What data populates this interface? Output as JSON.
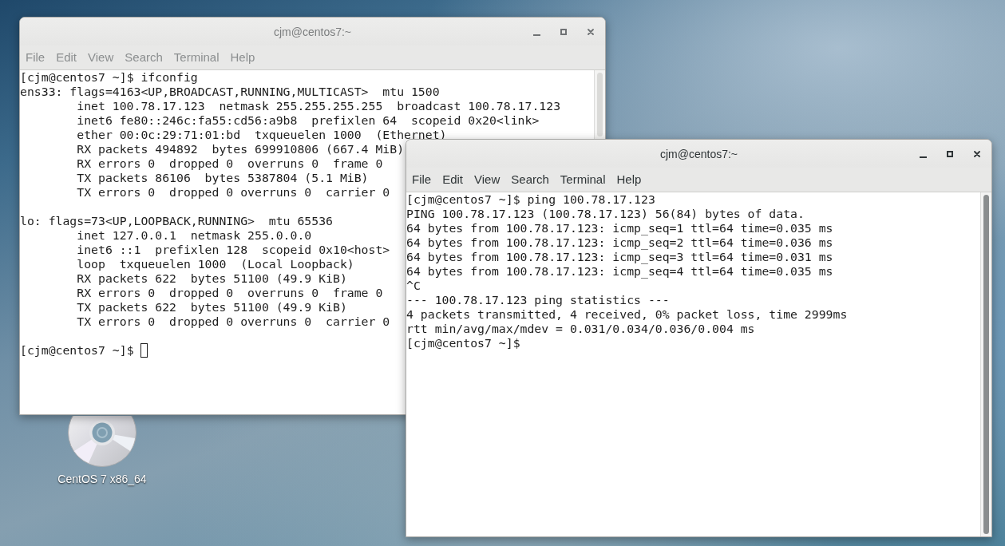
{
  "desktop": {
    "icons": [
      {
        "label": "CentOS 7 x86_64"
      }
    ]
  },
  "windows": [
    {
      "title": "cjm@centos7:~",
      "active": false,
      "menu": [
        "File",
        "Edit",
        "View",
        "Search",
        "Terminal",
        "Help"
      ],
      "cursor": true,
      "blocks": [
        {
          "lines": [
            {
              "text": "[cjm@centos7 ~]$ ifconfig"
            },
            {
              "text": "ens33: flags=4163<UP,BROADCAST,RUNNING,MULTICAST>  mtu 1500",
              "children": [
                {
                  "text": "inet 100.78.17.123  netmask 255.255.255.255  broadcast 100.78.17.123"
                },
                {
                  "text": "inet6 fe80::246c:fa55:cd56:a9b8  prefixlen 64  scopeid 0x20<link>"
                },
                {
                  "text": "ether 00:0c:29:71:01:bd  txqueuelen 1000  (Ethernet)"
                },
                {
                  "text": "RX packets 494892  bytes 699910806 (667.4 MiB)"
                },
                {
                  "text": "RX errors 0  dropped 0  overruns 0  frame 0"
                },
                {
                  "text": "TX packets 86106  bytes 5387804 (5.1 MiB)"
                },
                {
                  "text": "TX errors 0  dropped 0 overruns 0  carrier 0"
                }
              ]
            }
          ]
        },
        {
          "lines": [
            {
              "text": "lo: flags=73<UP,LOOPBACK,RUNNING>  mtu 65536",
              "children": [
                {
                  "text": "inet 127.0.0.1  netmask 255.0.0.0"
                },
                {
                  "text": "inet6 ::1  prefixlen 128  scopeid 0x10<host>"
                },
                {
                  "text": "loop  txqueuelen 1000  (Local Loopback)"
                },
                {
                  "text": "RX packets 622  bytes 51100 (49.9 KiB)"
                },
                {
                  "text": "RX errors 0  dropped 0  overruns 0  frame 0"
                },
                {
                  "text": "TX packets 622  bytes 51100 (49.9 KiB)"
                },
                {
                  "text": "TX errors 0  dropped 0 overruns 0  carrier 0"
                }
              ]
            }
          ]
        },
        {
          "lines": [
            {
              "text": "[cjm@centos7 ~]$"
            }
          ]
        }
      ]
    },
    {
      "title": "cjm@centos7:~",
      "active": true,
      "menu": [
        "File",
        "Edit",
        "View",
        "Search",
        "Terminal",
        "Help"
      ],
      "cursor": false,
      "blocks": [
        {
          "lines": [
            {
              "text": "[cjm@centos7 ~]$ ping 100.78.17.123"
            },
            {
              "text": "PING 100.78.17.123 (100.78.17.123) 56(84) bytes of data."
            },
            {
              "text": "64 bytes from 100.78.17.123: icmp_seq=1 ttl=64 time=0.035 ms"
            },
            {
              "text": "64 bytes from 100.78.17.123: icmp_seq=2 ttl=64 time=0.036 ms"
            },
            {
              "text": "64 bytes from 100.78.17.123: icmp_seq=3 ttl=64 time=0.031 ms"
            },
            {
              "text": "64 bytes from 100.78.17.123: icmp_seq=4 ttl=64 time=0.035 ms"
            },
            {
              "text": "^C"
            },
            {
              "text": "--- 100.78.17.123 ping statistics ---"
            },
            {
              "text": "4 packets transmitted, 4 received, 0% packet loss, time 2999ms"
            },
            {
              "text": "rtt min/avg/max/mdev = 0.031/0.034/0.036/0.004 ms"
            },
            {
              "text": "[cjm@centos7 ~]$"
            }
          ]
        }
      ]
    }
  ]
}
